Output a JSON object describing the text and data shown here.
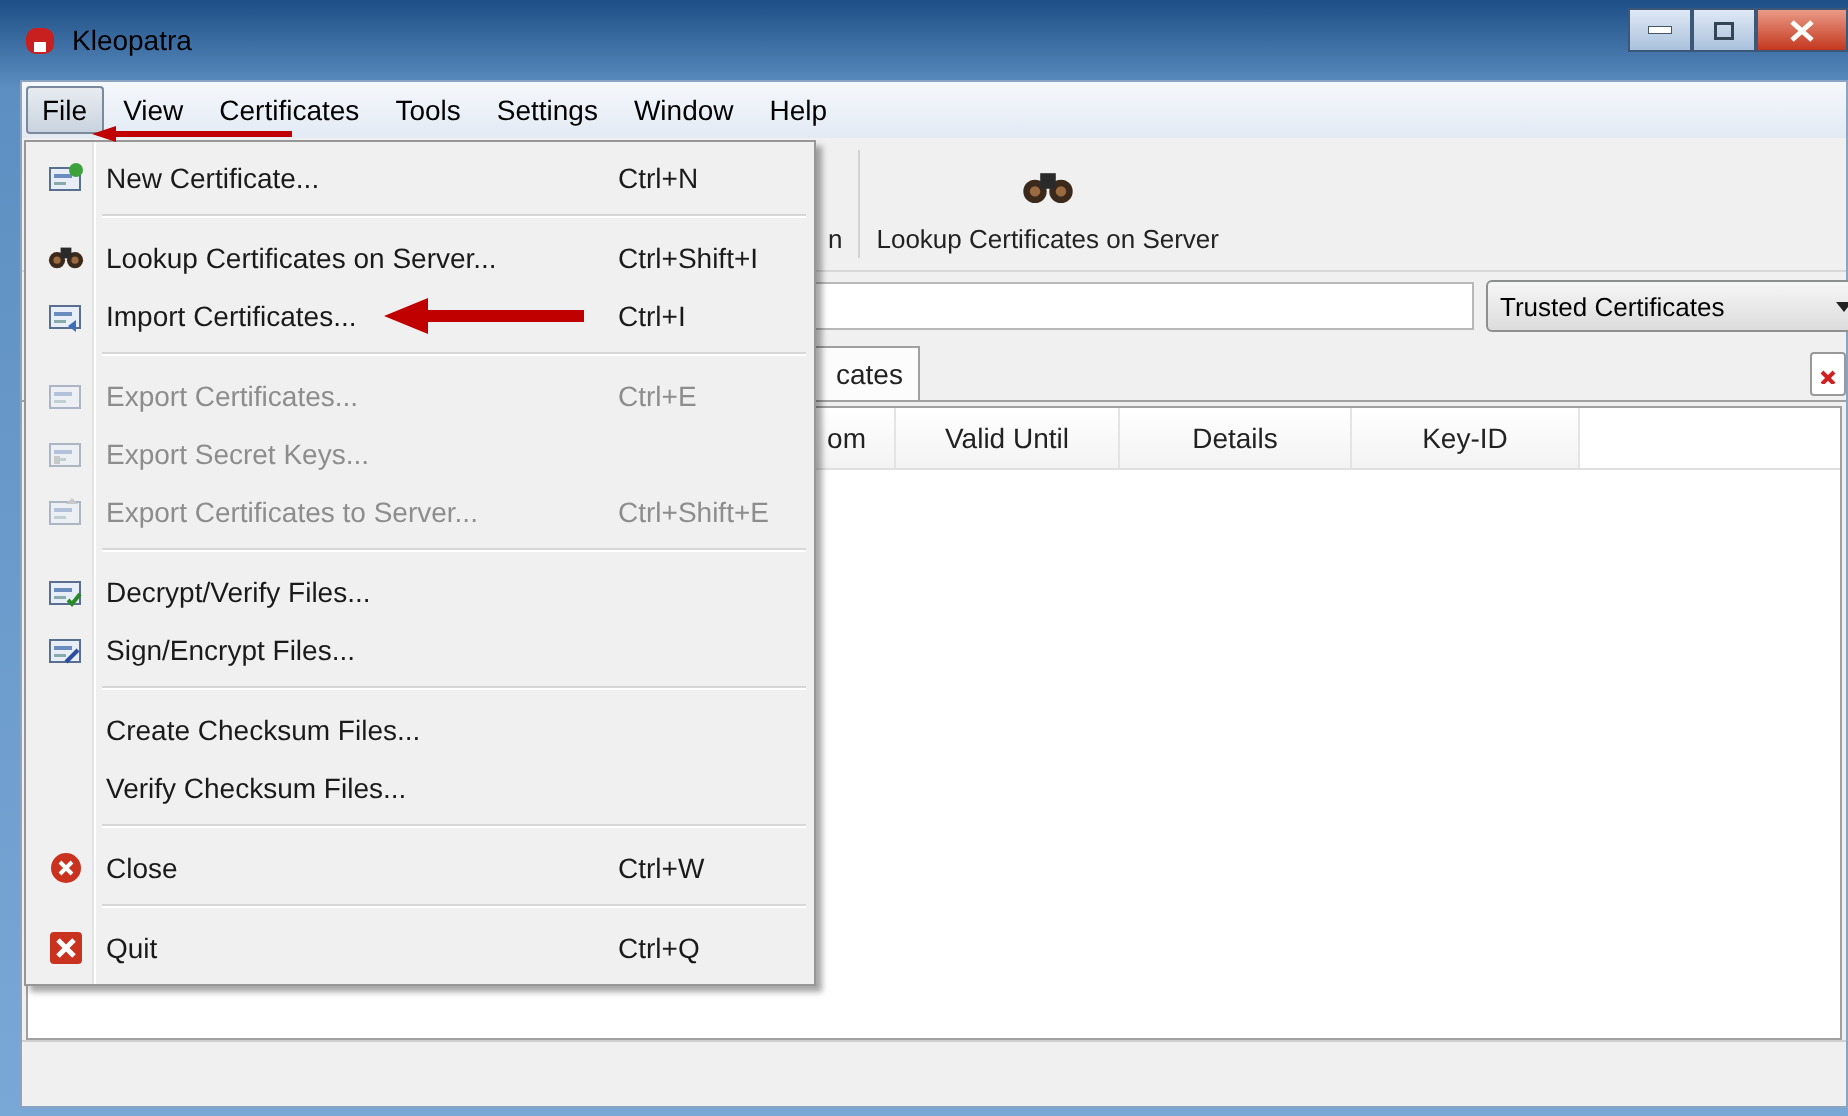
{
  "window": {
    "title": "Kleopatra"
  },
  "menubar": [
    {
      "label": "File",
      "selected": true
    },
    {
      "label": "View",
      "selected": false
    },
    {
      "label": "Certificates",
      "selected": false
    },
    {
      "label": "Tools",
      "selected": false
    },
    {
      "label": "Settings",
      "selected": false
    },
    {
      "label": "Window",
      "selected": false
    },
    {
      "label": "Help",
      "selected": false
    }
  ],
  "file_menu": [
    {
      "kind": "item",
      "label": "New Certificate...",
      "shortcut": "Ctrl+N",
      "disabled": false
    },
    {
      "kind": "separator"
    },
    {
      "kind": "item",
      "label": "Lookup Certificates on Server...",
      "shortcut": "Ctrl+Shift+I",
      "disabled": false
    },
    {
      "kind": "item",
      "label": "Import Certificates...",
      "shortcut": "Ctrl+I",
      "disabled": false
    },
    {
      "kind": "separator"
    },
    {
      "kind": "item",
      "label": "Export Certificates...",
      "shortcut": "Ctrl+E",
      "disabled": true
    },
    {
      "kind": "item",
      "label": "Export Secret Keys...",
      "disabled": true
    },
    {
      "kind": "item",
      "label": "Export Certificates to Server...",
      "shortcut": "Ctrl+Shift+E",
      "disabled": true
    },
    {
      "kind": "separator"
    },
    {
      "kind": "item",
      "label": "Decrypt/Verify Files...",
      "disabled": false
    },
    {
      "kind": "item",
      "label": "Sign/Encrypt Files...",
      "disabled": false
    },
    {
      "kind": "separator"
    },
    {
      "kind": "item",
      "label": "Create Checksum Files...",
      "disabled": false
    },
    {
      "kind": "item",
      "label": "Verify Checksum Files...",
      "disabled": false
    },
    {
      "kind": "separator"
    },
    {
      "kind": "item",
      "label": "Close",
      "shortcut": "Ctrl+W",
      "disabled": false
    },
    {
      "kind": "separator"
    },
    {
      "kind": "item",
      "label": "Quit",
      "shortcut": "Ctrl+Q",
      "disabled": false
    }
  ],
  "toolbar": [
    {
      "label": "n"
    },
    {
      "label": "Lookup Certificates on Server"
    }
  ],
  "filter": {
    "selected_value": "Trusted Certificates"
  },
  "tabs": [
    {
      "label": "cates",
      "selected": true
    }
  ],
  "table": {
    "columns": [
      "om",
      "Valid Until",
      "Details",
      "Key-ID"
    ]
  }
}
